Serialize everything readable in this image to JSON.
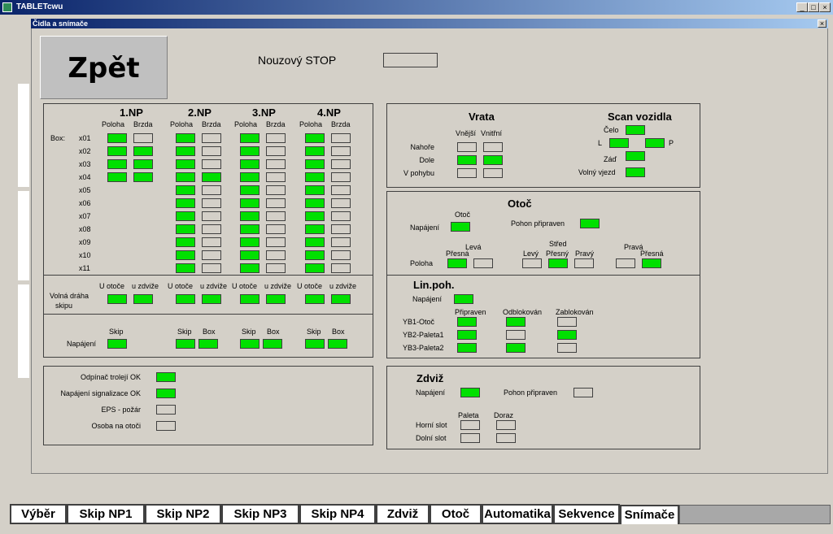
{
  "window": {
    "title": "TABLETcwu",
    "buttons": {
      "min": "_",
      "max": "□",
      "close": "×"
    }
  },
  "inner": {
    "title": "Čidla a snímače",
    "close": "×"
  },
  "back_label": "Zpět",
  "stop": {
    "label": "Nouzový STOP",
    "state": "off"
  },
  "boxes": {
    "floors": [
      "1.NP",
      "2.NP",
      "3.NP",
      "4.NP"
    ],
    "col_poloha": "Poloha",
    "col_brzda": "Brzda",
    "box_label": "Box:",
    "rows": [
      "x01",
      "x02",
      "x03",
      "x04",
      "x05",
      "x06",
      "x07",
      "x08",
      "x09",
      "x10",
      "x11"
    ],
    "values": [
      [
        [
          1,
          0
        ],
        [
          1,
          1
        ],
        [
          1,
          1
        ],
        [
          1,
          1
        ],
        null,
        null,
        null,
        null,
        null,
        null,
        null
      ],
      [
        [
          1,
          0
        ],
        [
          1,
          0
        ],
        [
          1,
          0
        ],
        [
          1,
          1
        ],
        [
          1,
          0
        ],
        [
          1,
          0
        ],
        [
          1,
          0
        ],
        [
          1,
          0
        ],
        [
          1,
          0
        ],
        [
          1,
          0
        ],
        [
          1,
          0
        ]
      ],
      [
        [
          1,
          0
        ],
        [
          1,
          0
        ],
        [
          1,
          0
        ],
        [
          1,
          0
        ],
        [
          1,
          0
        ],
        [
          1,
          0
        ],
        [
          1,
          0
        ],
        [
          1,
          0
        ],
        [
          1,
          0
        ],
        [
          1,
          0
        ],
        [
          1,
          0
        ]
      ],
      [
        [
          1,
          0
        ],
        [
          1,
          0
        ],
        [
          1,
          0
        ],
        [
          1,
          0
        ],
        [
          1,
          0
        ],
        [
          1,
          0
        ],
        [
          1,
          0
        ],
        [
          1,
          0
        ],
        [
          1,
          0
        ],
        [
          1,
          0
        ],
        [
          1,
          0
        ]
      ]
    ]
  },
  "free_path": {
    "label_1": "Volná dráha",
    "label_2": "skipu",
    "col_a": "U otoče",
    "col_b": "u zdviže",
    "values": [
      [
        1,
        1
      ],
      [
        1,
        1
      ],
      [
        1,
        1
      ],
      [
        1,
        1
      ]
    ]
  },
  "power": {
    "label": "Napájení",
    "col_skip": "Skip",
    "col_box": "Box",
    "values": [
      [
        1
      ],
      [
        1,
        1
      ],
      [
        1,
        1
      ],
      [
        1,
        1
      ]
    ]
  },
  "misc": [
    {
      "label": "Odpínač trolejí OK",
      "state": 1
    },
    {
      "label": "Napájení signalizace OK",
      "state": 1
    },
    {
      "label": "EPS - požár",
      "state": 0
    },
    {
      "label": "Osoba na otoči",
      "state": 0
    }
  ],
  "vrata": {
    "title": "Vrata",
    "col_a": "Vnější",
    "col_b": "Vnitřní",
    "rows": [
      {
        "label": "Nahoře",
        "v": [
          0,
          0
        ]
      },
      {
        "label": "Dole",
        "v": [
          1,
          1
        ]
      },
      {
        "label": "V pohybu",
        "v": [
          0,
          0
        ]
      }
    ]
  },
  "scan": {
    "title": "Scan vozidla",
    "celo": "Čelo",
    "l": "L",
    "p": "P",
    "zad": "Záď",
    "free": "Volný vjezd",
    "states": {
      "celo": 1,
      "l": 1,
      "p": 1,
      "zad": 1,
      "free": 1
    }
  },
  "otoc": {
    "title": "Otoč",
    "power": "Napájení",
    "otoc_lbl": "Otoč",
    "drive": "Pohon připraven",
    "poloha": "Poloha",
    "leva": "Levá",
    "presna": "Přesná",
    "levy": "Levý",
    "stred": "Střed",
    "presny": "Přesný",
    "pravy": "Pravý",
    "prava": "Pravá",
    "presna2": "Přesná",
    "states": {
      "power": 1,
      "drive": 1,
      "leva_presna": 1,
      "leva_x": 0,
      "levy": 0,
      "presny": 1,
      "pravy": 0,
      "prava_x": 0,
      "prava_presna": 1
    }
  },
  "linpoh": {
    "title": "Lin.poh.",
    "power": "Napájení",
    "power_state": 1,
    "col_a": "Připraven",
    "col_b": "Odblokován",
    "col_c": "Zablokován",
    "rows": [
      {
        "label": "YB1-Otoč",
        "v": [
          1,
          1,
          0
        ]
      },
      {
        "label": "YB2-Paleta1",
        "v": [
          1,
          0,
          1
        ]
      },
      {
        "label": "YB3-Paleta2",
        "v": [
          1,
          1,
          0
        ]
      }
    ]
  },
  "zdviz": {
    "title": "Zdviž",
    "power": "Napájení",
    "power_state": 1,
    "drive": "Pohon připraven",
    "drive_state": 0,
    "col_a": "Paleta",
    "col_b": "Doraz",
    "rows": [
      {
        "label": "Horní slot",
        "v": [
          0,
          0
        ]
      },
      {
        "label": "Dolní slot",
        "v": [
          0,
          0
        ]
      }
    ]
  },
  "tabs": [
    "Výběr",
    "Skip NP1",
    "Skip NP2",
    "Skip NP3",
    "Skip NP4",
    "Zdviž",
    "Otoč",
    "Automatika",
    "Sekvence",
    "Snímače"
  ],
  "active_tab": "Snímače",
  "colors": {
    "on": "#00e000",
    "off": "#d4d0c8",
    "title_start": "#0a246a",
    "title_end": "#a6caf0"
  }
}
